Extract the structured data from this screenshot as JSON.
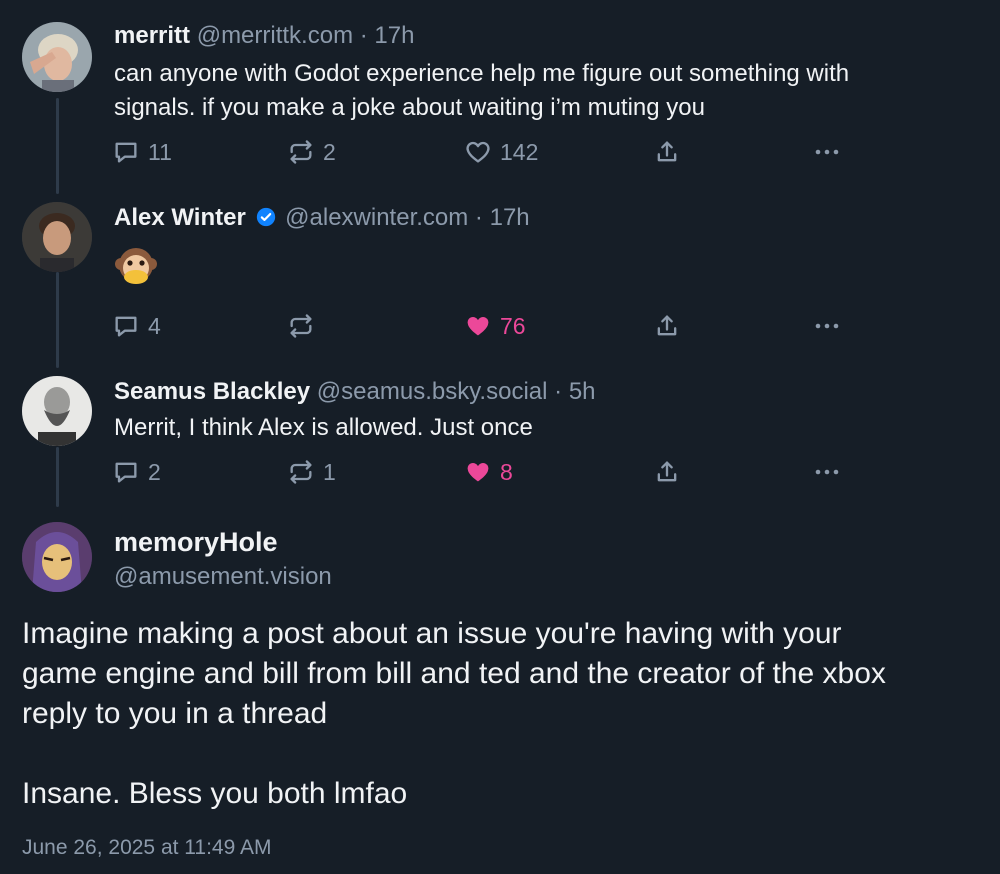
{
  "posts": [
    {
      "name": "merritt",
      "handle": "@merrittk.com",
      "separator": "·",
      "time": "17h",
      "text_lines": [
        "can anyone with Godot experience help me figure out something with",
        "signals. if you make a joke about waiting i’m muting you"
      ],
      "replies": "11",
      "reposts": "2",
      "likes": "142",
      "liked": false
    },
    {
      "name": "Alex Winter",
      "verified": true,
      "handle": "@alexwinter.com",
      "separator": "·",
      "time": "17h",
      "emoji": "speak-no-evil-monkey",
      "replies": "4",
      "reposts": "",
      "likes": "76",
      "liked": true
    },
    {
      "name": "Seamus Blackley",
      "handle": "@seamus.bsky.social",
      "separator": "·",
      "time": "5h",
      "text_lines": [
        "Merrit, I think Alex is allowed. Just once"
      ],
      "replies": "2",
      "reposts": "1",
      "likes": "8",
      "liked": true
    }
  ],
  "main_post": {
    "name": "memoryHole",
    "handle": "@amusement.vision",
    "text_lines": [
      "Imagine making a post about an issue you're having with your",
      "game engine and bill from bill and ted and the creator of the xbox",
      "reply to you in a thread",
      "",
      "Insane. Bless you both lmfao"
    ],
    "timestamp": "June 26, 2025 at 11:49 AM"
  },
  "colors": {
    "background": "#161e27",
    "muted": "#8c9aab",
    "like_accent": "#ec4899",
    "verified": "#1083fe"
  },
  "icons": [
    "reply-icon",
    "repost-icon",
    "like-icon",
    "share-icon",
    "more-icon",
    "verified-badge-icon"
  ]
}
